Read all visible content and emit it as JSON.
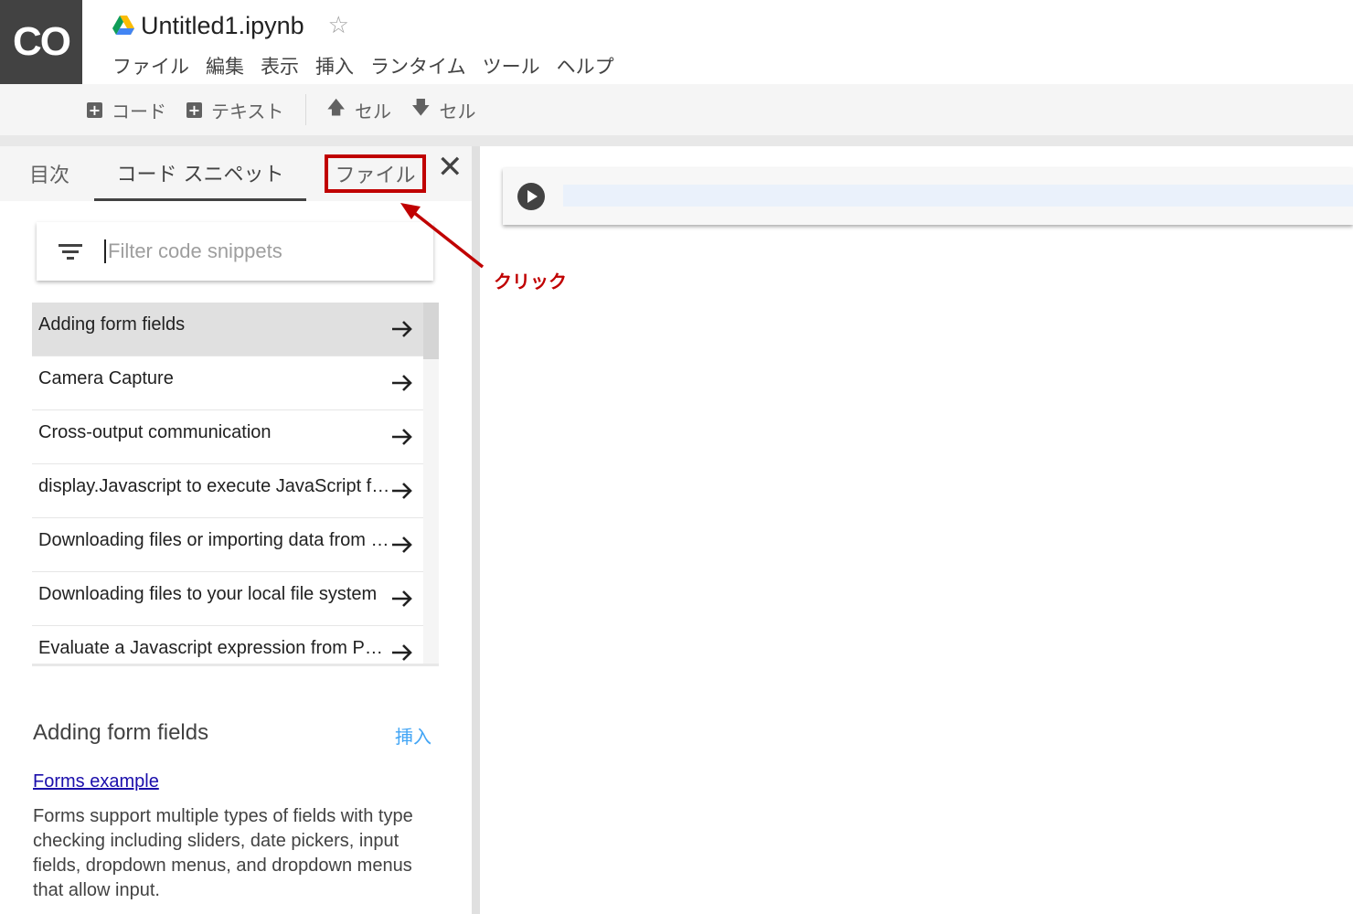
{
  "app": {
    "logo_text": "CO",
    "doc_title": "Untitled1.ipynb",
    "star_glyph": "☆"
  },
  "menu": [
    "ファイル",
    "編集",
    "表示",
    "挿入",
    "ランタイム",
    "ツール",
    "ヘルプ"
  ],
  "toolbar": {
    "add_code": "コード",
    "add_text": "テキスト",
    "cell_up": "セル",
    "cell_down": "セル"
  },
  "side_panel": {
    "tabs": {
      "toc": "目次",
      "snippets": "コード スニペット",
      "files": "ファイル"
    },
    "close_glyph": "✕",
    "filter_placeholder": "Filter code snippets",
    "snippets": [
      "Adding form fields",
      "Camera Capture",
      "Cross-output communication",
      "display.Javascript to execute JavaScript from Python",
      "Downloading files or importing data from Google Drive",
      "Downloading files to your local file system",
      "Evaluate a Javascript expression from Python"
    ],
    "selected_index": 0,
    "detail": {
      "title": "Adding form fields",
      "insert_label": "挿入",
      "link_text": "Forms example",
      "description": "Forms support multiple types of fields with type checking including sliders, date pickers, input fields, dropdown menus, and dropdown menus that allow input."
    }
  },
  "annotation": {
    "label": "クリック",
    "color": "#c00000"
  },
  "icons": {
    "drive": "google-drive-icon",
    "star": "star-outline-icon",
    "add": "plus-box-icon",
    "up": "arrow-up-icon",
    "down": "arrow-down-icon",
    "filter": "filter-list-icon",
    "arrow": "arrow-right-icon",
    "close": "close-icon",
    "run": "play-circle-icon"
  }
}
